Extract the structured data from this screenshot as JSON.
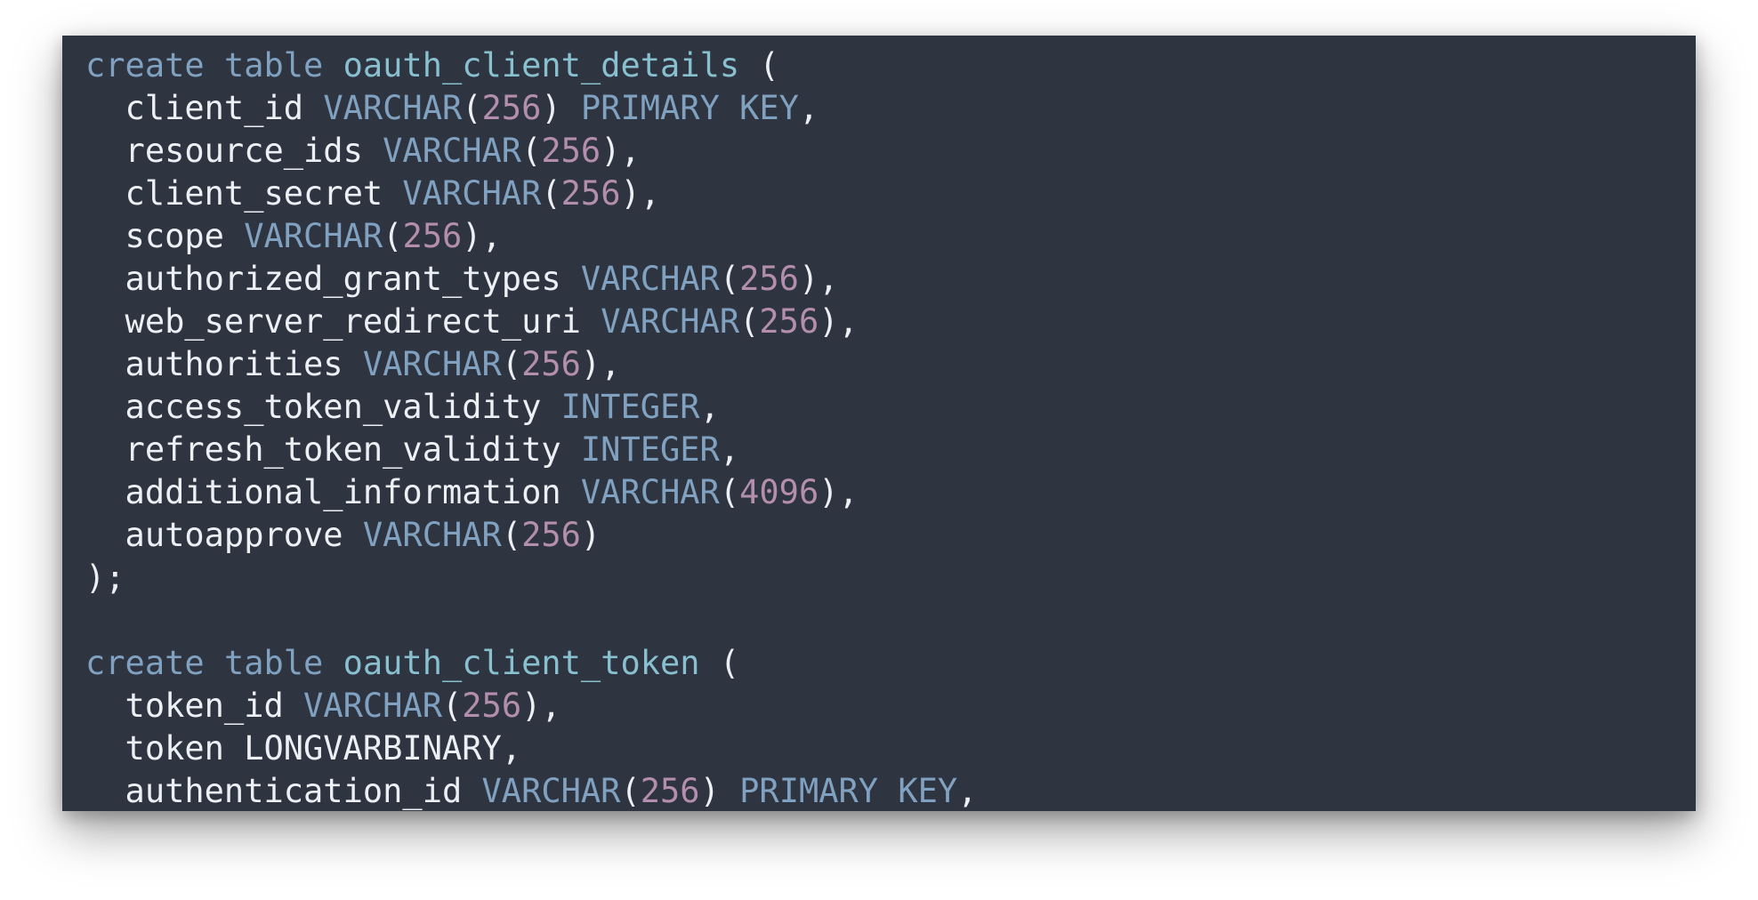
{
  "colors": {
    "background": "#2e3440",
    "text": "#eceff4",
    "keyword": "#81a1c1",
    "identifier": "#88c0d0",
    "type": "#81a1c1",
    "number": "#b48ead"
  },
  "code": {
    "language": "sql",
    "lines": [
      [
        {
          "t": "kw",
          "v": "create"
        },
        {
          "t": "plain",
          "v": " "
        },
        {
          "t": "kw",
          "v": "table"
        },
        {
          "t": "plain",
          "v": " "
        },
        {
          "t": "name",
          "v": "oauth_client_details"
        },
        {
          "t": "plain",
          "v": " ("
        }
      ],
      [
        {
          "t": "plain",
          "v": "  client_id "
        },
        {
          "t": "type",
          "v": "VARCHAR"
        },
        {
          "t": "plain",
          "v": "("
        },
        {
          "t": "num",
          "v": "256"
        },
        {
          "t": "plain",
          "v": ") "
        },
        {
          "t": "type",
          "v": "PRIMARY KEY"
        },
        {
          "t": "plain",
          "v": ","
        }
      ],
      [
        {
          "t": "plain",
          "v": "  resource_ids "
        },
        {
          "t": "type",
          "v": "VARCHAR"
        },
        {
          "t": "plain",
          "v": "("
        },
        {
          "t": "num",
          "v": "256"
        },
        {
          "t": "plain",
          "v": "),"
        }
      ],
      [
        {
          "t": "plain",
          "v": "  client_secret "
        },
        {
          "t": "type",
          "v": "VARCHAR"
        },
        {
          "t": "plain",
          "v": "("
        },
        {
          "t": "num",
          "v": "256"
        },
        {
          "t": "plain",
          "v": "),"
        }
      ],
      [
        {
          "t": "plain",
          "v": "  scope "
        },
        {
          "t": "type",
          "v": "VARCHAR"
        },
        {
          "t": "plain",
          "v": "("
        },
        {
          "t": "num",
          "v": "256"
        },
        {
          "t": "plain",
          "v": "),"
        }
      ],
      [
        {
          "t": "plain",
          "v": "  authorized_grant_types "
        },
        {
          "t": "type",
          "v": "VARCHAR"
        },
        {
          "t": "plain",
          "v": "("
        },
        {
          "t": "num",
          "v": "256"
        },
        {
          "t": "plain",
          "v": "),"
        }
      ],
      [
        {
          "t": "plain",
          "v": "  web_server_redirect_uri "
        },
        {
          "t": "type",
          "v": "VARCHAR"
        },
        {
          "t": "plain",
          "v": "("
        },
        {
          "t": "num",
          "v": "256"
        },
        {
          "t": "plain",
          "v": "),"
        }
      ],
      [
        {
          "t": "plain",
          "v": "  authorities "
        },
        {
          "t": "type",
          "v": "VARCHAR"
        },
        {
          "t": "plain",
          "v": "("
        },
        {
          "t": "num",
          "v": "256"
        },
        {
          "t": "plain",
          "v": "),"
        }
      ],
      [
        {
          "t": "plain",
          "v": "  access_token_validity "
        },
        {
          "t": "type",
          "v": "INTEGER"
        },
        {
          "t": "plain",
          "v": ","
        }
      ],
      [
        {
          "t": "plain",
          "v": "  refresh_token_validity "
        },
        {
          "t": "type",
          "v": "INTEGER"
        },
        {
          "t": "plain",
          "v": ","
        }
      ],
      [
        {
          "t": "plain",
          "v": "  additional_information "
        },
        {
          "t": "type",
          "v": "VARCHAR"
        },
        {
          "t": "plain",
          "v": "("
        },
        {
          "t": "num",
          "v": "4096"
        },
        {
          "t": "plain",
          "v": "),"
        }
      ],
      [
        {
          "t": "plain",
          "v": "  autoapprove "
        },
        {
          "t": "type",
          "v": "VARCHAR"
        },
        {
          "t": "plain",
          "v": "("
        },
        {
          "t": "num",
          "v": "256"
        },
        {
          "t": "plain",
          "v": ")"
        }
      ],
      [
        {
          "t": "plain",
          "v": ");"
        }
      ],
      [
        {
          "t": "plain",
          "v": ""
        }
      ],
      [
        {
          "t": "kw",
          "v": "create"
        },
        {
          "t": "plain",
          "v": " "
        },
        {
          "t": "kw",
          "v": "table"
        },
        {
          "t": "plain",
          "v": " "
        },
        {
          "t": "name",
          "v": "oauth_client_token"
        },
        {
          "t": "plain",
          "v": " ("
        }
      ],
      [
        {
          "t": "plain",
          "v": "  token_id "
        },
        {
          "t": "type",
          "v": "VARCHAR"
        },
        {
          "t": "plain",
          "v": "("
        },
        {
          "t": "num",
          "v": "256"
        },
        {
          "t": "plain",
          "v": "),"
        }
      ],
      [
        {
          "t": "plain",
          "v": "  token LONGVARBINARY,"
        }
      ],
      [
        {
          "t": "plain",
          "v": "  authentication_id "
        },
        {
          "t": "type",
          "v": "VARCHAR"
        },
        {
          "t": "plain",
          "v": "("
        },
        {
          "t": "num",
          "v": "256"
        },
        {
          "t": "plain",
          "v": ") "
        },
        {
          "t": "type",
          "v": "PRIMARY KEY"
        },
        {
          "t": "plain",
          "v": ","
        }
      ]
    ]
  }
}
